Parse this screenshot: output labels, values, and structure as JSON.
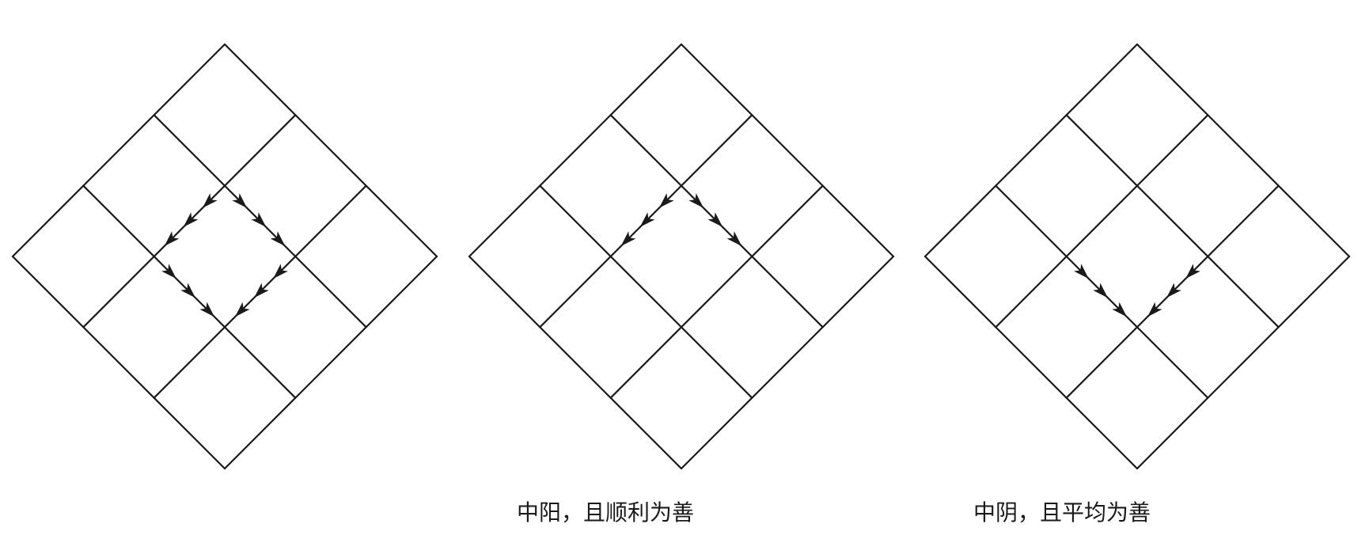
{
  "captions": {
    "diagram_1": "",
    "diagram_2": "中阳，且顺利为善",
    "diagram_3": "中阴，且平均为善"
  },
  "grid": {
    "rows": 3,
    "cols": 3
  },
  "colors": {
    "line": "#1a1a1a",
    "arrow": "#1a1a1a",
    "background": "#ffffff"
  },
  "diagrams": [
    {
      "id": "diagram-1",
      "arrow_paths": [
        {
          "from": [
            1,
            1
          ],
          "to": [
            1,
            2
          ],
          "arrows": 3
        },
        {
          "from": [
            1,
            1
          ],
          "to": [
            2,
            1
          ],
          "arrows": 3
        },
        {
          "from": [
            2,
            1
          ],
          "to": [
            2,
            2
          ],
          "arrows": 3
        },
        {
          "from": [
            1,
            2
          ],
          "to": [
            2,
            2
          ],
          "arrows": 3
        }
      ]
    },
    {
      "id": "diagram-2",
      "arrow_paths": [
        {
          "from": [
            1,
            1
          ],
          "to": [
            1,
            2
          ],
          "arrows": 3
        },
        {
          "from": [
            1,
            1
          ],
          "to": [
            2,
            1
          ],
          "arrows": 3
        }
      ]
    },
    {
      "id": "diagram-3",
      "arrow_paths": [
        {
          "from": [
            2,
            1
          ],
          "to": [
            2,
            2
          ],
          "arrows": 3
        },
        {
          "from": [
            1,
            2
          ],
          "to": [
            2,
            2
          ],
          "arrows": 3
        }
      ]
    }
  ]
}
